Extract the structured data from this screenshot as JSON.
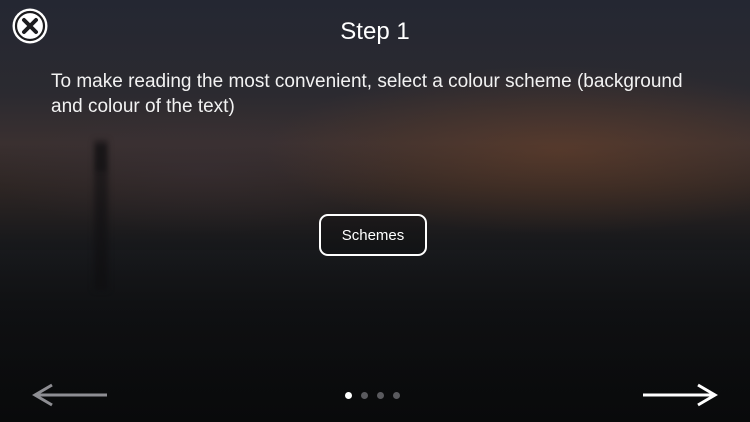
{
  "header": {
    "title": "Step 1"
  },
  "main": {
    "description": "To make reading the most convenient, select a colour scheme (background and colour of the text)",
    "schemes_button_label": "Schemes"
  },
  "pagination": {
    "total_pages": 4,
    "current_page": 1
  },
  "icons": {
    "close": "close-icon",
    "back": "arrow-left-icon",
    "next": "arrow-right-icon"
  },
  "colors": {
    "text": "#ffffff",
    "inactive_arrow": "#8e8e93",
    "active_dot": "#ffffff",
    "inactive_dot": "#5a5a5e"
  }
}
